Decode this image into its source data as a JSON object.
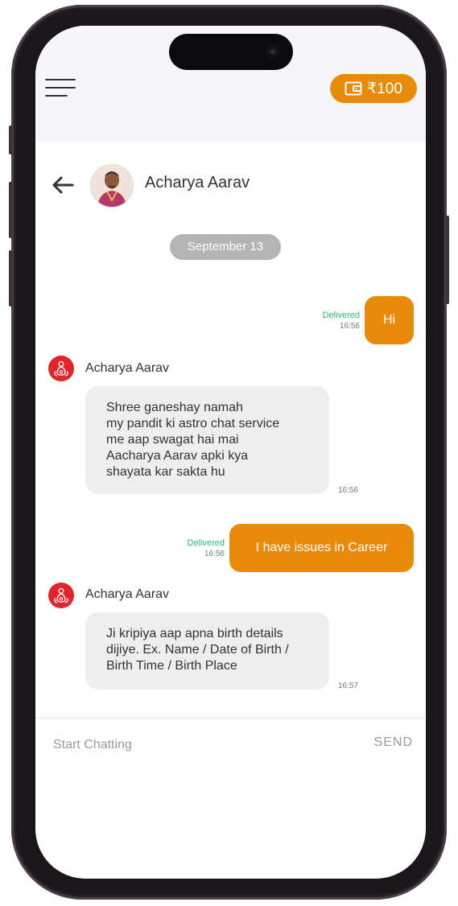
{
  "wallet": {
    "balance": "₹100"
  },
  "chat_header": {
    "name": "Acharya Aarav"
  },
  "date_separator": "September 13",
  "messages": [
    {
      "direction": "outgoing",
      "text": "Hi",
      "status": "Delivered",
      "time": "16:56"
    },
    {
      "direction": "incoming",
      "sender": "Acharya Aarav",
      "text": "Shree ganeshay namah\nmy pandit ki astro chat service\nme aap swagat hai mai\nAacharya Aarav apki kya\nshayata kar sakta hu",
      "time": "16:56"
    },
    {
      "direction": "outgoing",
      "text": "I have issues in Career",
      "status": "Delivered",
      "time": "16:56"
    },
    {
      "direction": "incoming",
      "sender": "Acharya Aarav",
      "text": "Ji kripiya aap apna birth details\ndijiye. Ex. Name / Date of Birth /\nBirth Time / Birth Place",
      "time": "16:57"
    }
  ],
  "composer": {
    "placeholder": "Start Chatting",
    "send_label": "SEND"
  },
  "colors": {
    "accent": "#e88a0a",
    "delivered": "#2bb673",
    "brand_red": "#e0262b"
  }
}
